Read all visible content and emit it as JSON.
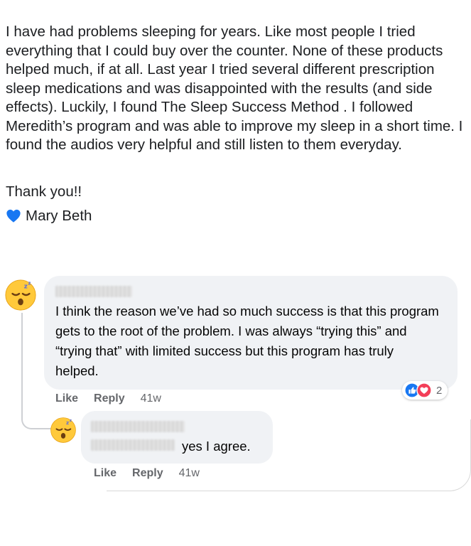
{
  "post": {
    "text": "I have had problems sleeping for years. Like most people I tried everything that I could buy over the counter. None of these products helped much, if at all. Last year I tried several different prescription sleep medications and was disappointed with the results (and side effects). Luckily, I found The Sleep Success Method . I followed Meredith’s program and was able to improve my sleep in a short time. I found the audios very helpful and still listen to them everyday.",
    "thanks": "Thank you!!",
    "signature": "Mary Beth",
    "heart_icon": "blue-heart-icon",
    "heart_color": "#1877f2"
  },
  "comments": [
    {
      "avatar_icon": "sleeping-face-emoji",
      "text": "I think the reason we’ve had so much success is that this program gets to the root of the problem. I was always “trying this” and “trying that” with limited success but this program has truly helped.",
      "like_label": "Like",
      "reply_label": "Reply",
      "time": "41w",
      "reaction_icons": [
        "like-icon",
        "love-icon"
      ],
      "reaction_count": "2"
    },
    {
      "avatar_icon": "sleeping-face-emoji",
      "text": "yes I agree.",
      "like_label": "Like",
      "reply_label": "Reply",
      "time": "41w"
    }
  ],
  "colors": {
    "bubble_bg": "#f0f2f5",
    "meta_text": "#65676b",
    "like_blue": "#1877f2",
    "love_red": "#f33e58"
  }
}
